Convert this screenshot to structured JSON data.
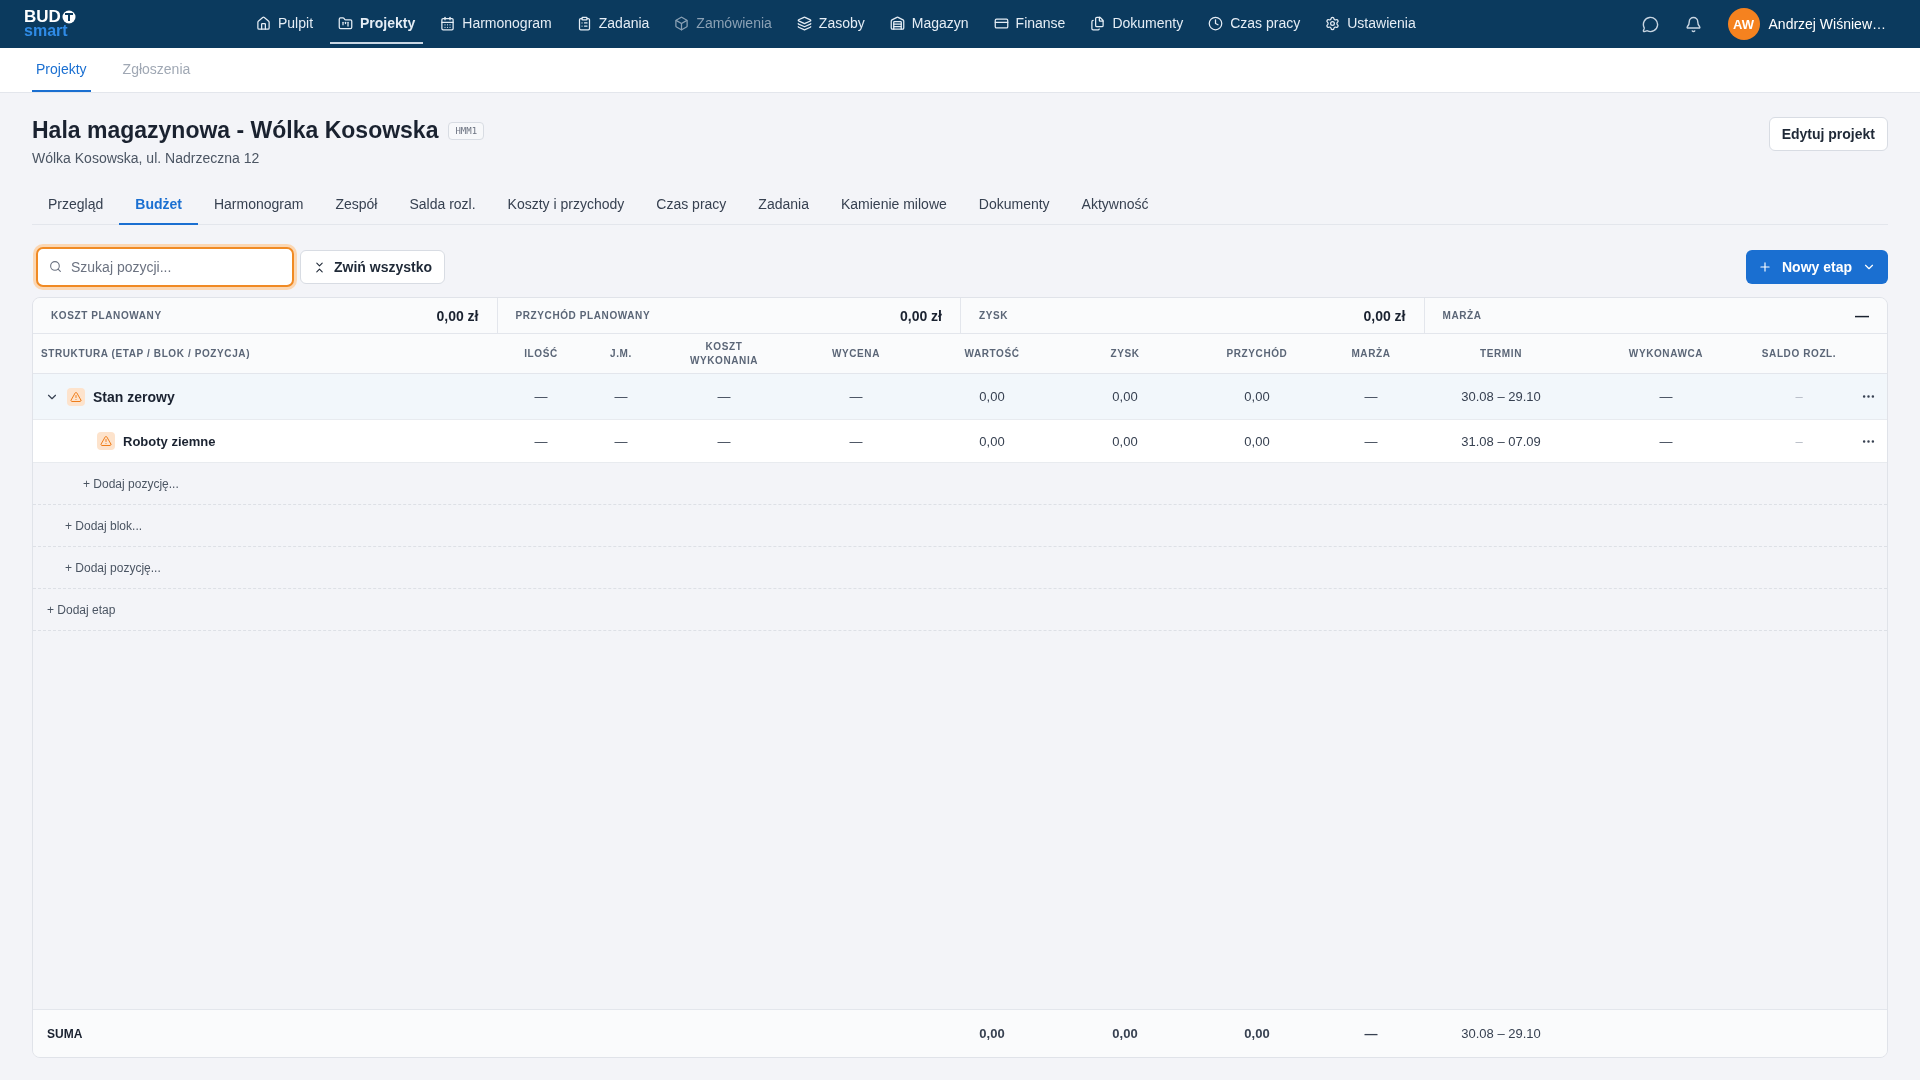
{
  "nav": {
    "logo": {
      "top": "BUD",
      "bottom": "smart"
    },
    "items": [
      {
        "label": "Pulpit",
        "selected": false,
        "disabled": false
      },
      {
        "label": "Projekty",
        "selected": true,
        "disabled": false
      },
      {
        "label": "Harmonogram",
        "selected": false,
        "disabled": false
      },
      {
        "label": "Zadania",
        "selected": false,
        "disabled": false
      },
      {
        "label": "Zamówienia",
        "selected": false,
        "disabled": true
      },
      {
        "label": "Zasoby",
        "selected": false,
        "disabled": false
      },
      {
        "label": "Magazyn",
        "selected": false,
        "disabled": false
      },
      {
        "label": "Finanse",
        "selected": false,
        "disabled": false
      },
      {
        "label": "Dokumenty",
        "selected": false,
        "disabled": false
      },
      {
        "label": "Czas pracy",
        "selected": false,
        "disabled": false
      },
      {
        "label": "Ustawienia",
        "selected": false,
        "disabled": false
      }
    ],
    "user": {
      "initials": "AW",
      "name": "Andrzej Wiśniew…"
    }
  },
  "subtabs": [
    {
      "label": "Projekty",
      "selected": true
    },
    {
      "label": "Zgłoszenia",
      "selected": false
    }
  ],
  "project": {
    "title": "Hala magazynowa - Wólka Kosowska",
    "code": "HMM1",
    "address": "Wólka Kosowska, ul. Nadrzeczna 12",
    "edit_button": "Edytuj projekt"
  },
  "tabs": [
    {
      "label": "Przegląd",
      "selected": false
    },
    {
      "label": "Budżet",
      "selected": true
    },
    {
      "label": "Harmonogram",
      "selected": false
    },
    {
      "label": "Zespół",
      "selected": false
    },
    {
      "label": "Salda rozl.",
      "selected": false
    },
    {
      "label": "Koszty i przychody",
      "selected": false
    },
    {
      "label": "Czas pracy",
      "selected": false
    },
    {
      "label": "Zadania",
      "selected": false
    },
    {
      "label": "Kamienie milowe",
      "selected": false
    },
    {
      "label": "Dokumenty",
      "selected": false
    },
    {
      "label": "Aktywność",
      "selected": false
    }
  ],
  "toolbar": {
    "search": {
      "placeholder": "Szukaj pozycji...",
      "focused": true
    },
    "collapse_button": "Zwiń wszystko",
    "new_button": "Nowy etap"
  },
  "summary": [
    {
      "label": "KOSZT PLANOWANY",
      "value": "0,00 zł"
    },
    {
      "label": "PRZYCHÓD PLANOWANY",
      "value": "0,00 zł"
    },
    {
      "label": "ZYSK",
      "value": "0,00 zł"
    },
    {
      "label": "MARŻA",
      "value": "—"
    }
  ],
  "table": {
    "columns": [
      "STRUKTURA (ETAP / BLOK / POZYCJA)",
      "ILOŚĆ",
      "J.M.",
      "KOSZT WYKONANIA",
      "WYCENA",
      "WARTOŚĆ",
      "ZYSK",
      "PRZYCHÓD",
      "MARŻA",
      "TERMIN",
      "WYKONAWCA",
      "SALDO ROZL."
    ],
    "rows": [
      {
        "kind": "stage",
        "name": "Stan zerowy",
        "expanded": true,
        "cells": [
          "—",
          "—",
          "—",
          "—",
          "0,00",
          "0,00",
          "0,00",
          "—",
          "30.08 – 29.10",
          "—",
          "–"
        ],
        "children": [
          {
            "kind": "block",
            "name": "Roboty ziemne",
            "cells": [
              "—",
              "—",
              "—",
              "—",
              "0,00",
              "0,00",
              "0,00",
              "—",
              "31.08 – 07.09",
              "—",
              "–"
            ],
            "children": [
              {
                "kind": "add",
                "label": "+ Dodaj pozycję..."
              }
            ]
          },
          {
            "kind": "add",
            "label": "+ Dodaj blok..."
          },
          {
            "kind": "add",
            "label": "+ Dodaj pozycję..."
          }
        ]
      },
      {
        "kind": "add",
        "label": "+ Dodaj etap"
      }
    ],
    "footer": {
      "label": "SUMA",
      "wartosc": "0,00",
      "zysk": "0,00",
      "przychod": "0,00",
      "marza": "—",
      "termin": "30.08 – 29.10"
    }
  }
}
